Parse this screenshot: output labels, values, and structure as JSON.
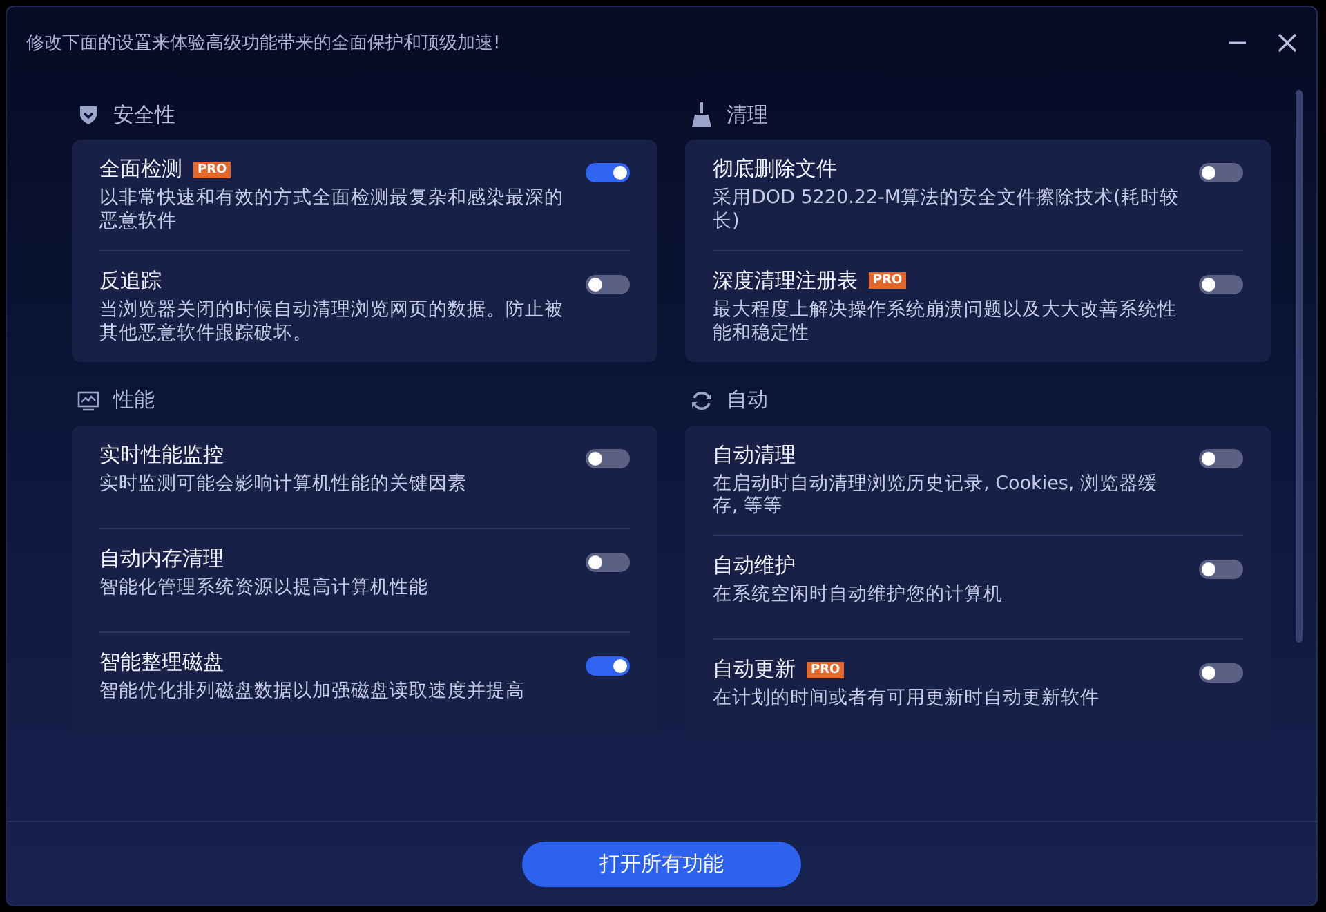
{
  "header": {
    "message": "修改下面的设置来体验高级功能带来的全面保护和顶级加速!"
  },
  "sections": [
    {
      "title": "安全性",
      "items": [
        {
          "title": "全面检测",
          "badge": "PRO",
          "on": true,
          "description": "以非常快速和有效的方式全面检测最复杂和感染最深的恶意软件"
        },
        {
          "title": "反追踪",
          "on": false,
          "description": "当浏览器关闭的时候自动清理浏览网页的数据。防止被其他恶意软件跟踪破坏。"
        }
      ]
    },
    {
      "title": "清理",
      "items": [
        {
          "title": "彻底删除文件",
          "on": false,
          "description": "采用DOD 5220.22-M算法的安全文件擦除技术(耗时较长)"
        },
        {
          "title": "深度清理注册表",
          "badge": "PRO",
          "on": false,
          "description": "最大程度上解决操作系统崩溃问题以及大大改善系统性能和稳定性"
        }
      ]
    },
    {
      "title": "性能",
      "items": [
        {
          "title": "实时性能监控",
          "on": false,
          "description": "实时监测可能会影响计算机性能的关键因素"
        },
        {
          "title": "自动内存清理",
          "on": false,
          "description": "智能化管理系统资源以提高计算机性能"
        },
        {
          "title": "智能整理磁盘",
          "on": true,
          "description": "智能优化排列磁盘数据以加强磁盘读取速度并提高"
        }
      ]
    },
    {
      "title": "自动",
      "items": [
        {
          "title": "自动清理",
          "on": false,
          "description": "在启动时自动清理浏览历史记录, Cookies, 浏览器缓存, 等等"
        },
        {
          "title": "自动维护",
          "on": false,
          "description": "在系统空闲时自动维护您的计算机"
        },
        {
          "title": "自动更新",
          "badge": "PRO",
          "on": false,
          "description": "在计划的时间或者有可用更新时自动更新软件"
        }
      ]
    }
  ],
  "footer": {
    "button": "打开所有功能"
  }
}
